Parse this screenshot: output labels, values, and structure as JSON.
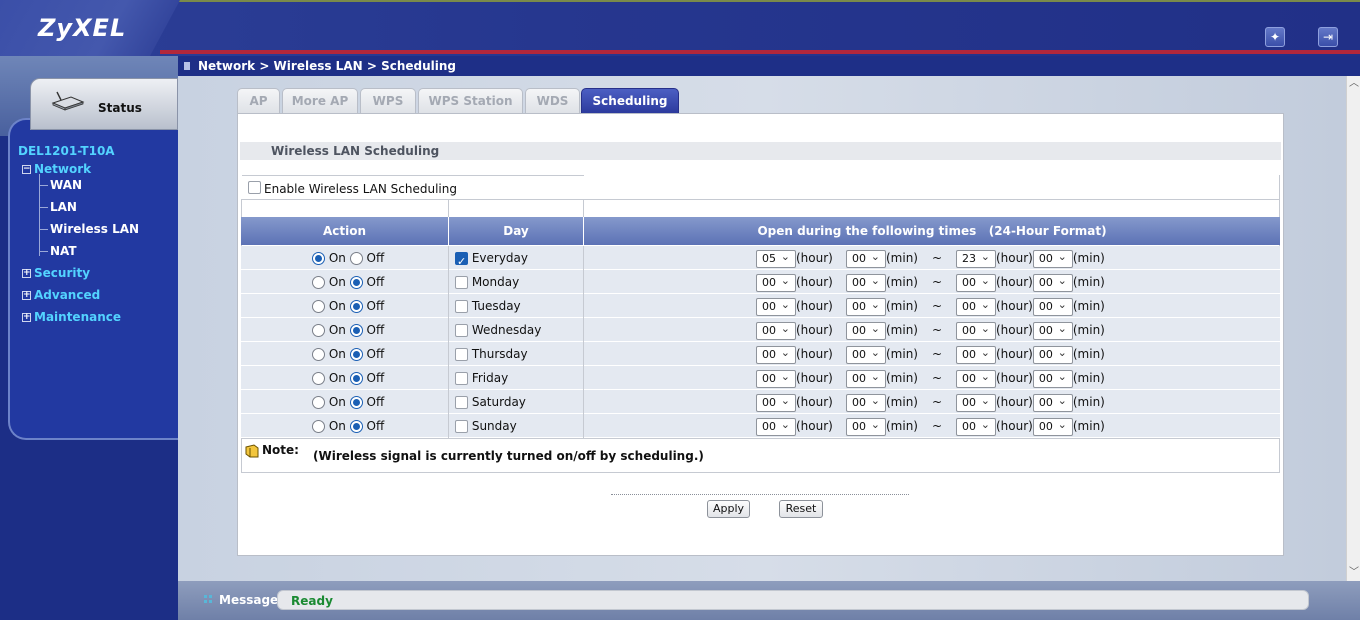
{
  "brand": {
    "logo": "ZyXEL"
  },
  "header": {
    "icons": [
      "wizard-icon",
      "logout-icon"
    ]
  },
  "sidebar": {
    "status_label": "Status",
    "device": "DEL1201-T10A",
    "network": "Network",
    "network_items": [
      "WAN",
      "LAN",
      "Wireless LAN",
      "NAT"
    ],
    "security": "Security",
    "advanced": "Advanced",
    "maintenance": "Maintenance"
  },
  "breadcrumb": "Network > Wireless LAN > Scheduling",
  "tabs": [
    "AP",
    "More AP",
    "WPS",
    "WPS Station",
    "WDS",
    "Scheduling"
  ],
  "active_tab": "Scheduling",
  "section": {
    "title": "Wireless LAN Scheduling",
    "enable_label": "Enable Wireless LAN Scheduling",
    "enable_checked": false
  },
  "table": {
    "headers": {
      "action": "Action",
      "day": "Day",
      "times": "Open during the following times   (24-Hour Format)"
    },
    "labels": {
      "on": "On",
      "off": "Off",
      "hour": "(hour)",
      "min": "(min)",
      "tilde": "~"
    },
    "rows": [
      {
        "day": "Everyday",
        "checked": true,
        "action": "On",
        "start_h": "05",
        "start_m": "00",
        "end_h": "23",
        "end_m": "00"
      },
      {
        "day": "Monday",
        "checked": false,
        "action": "Off",
        "start_h": "00",
        "start_m": "00",
        "end_h": "00",
        "end_m": "00"
      },
      {
        "day": "Tuesday",
        "checked": false,
        "action": "Off",
        "start_h": "00",
        "start_m": "00",
        "end_h": "00",
        "end_m": "00"
      },
      {
        "day": "Wednesday",
        "checked": false,
        "action": "Off",
        "start_h": "00",
        "start_m": "00",
        "end_h": "00",
        "end_m": "00"
      },
      {
        "day": "Thursday",
        "checked": false,
        "action": "Off",
        "start_h": "00",
        "start_m": "00",
        "end_h": "00",
        "end_m": "00"
      },
      {
        "day": "Friday",
        "checked": false,
        "action": "Off",
        "start_h": "00",
        "start_m": "00",
        "end_h": "00",
        "end_m": "00"
      },
      {
        "day": "Saturday",
        "checked": false,
        "action": "Off",
        "start_h": "00",
        "start_m": "00",
        "end_h": "00",
        "end_m": "00"
      },
      {
        "day": "Sunday",
        "checked": false,
        "action": "Off",
        "start_h": "00",
        "start_m": "00",
        "end_h": "00",
        "end_m": "00"
      }
    ]
  },
  "note": {
    "label": "Note:",
    "text": "(Wireless signal is currently turned on/off by scheduling.)"
  },
  "buttons": {
    "apply": "Apply",
    "reset": "Reset"
  },
  "statusbar": {
    "label": "Message",
    "value": "Ready"
  },
  "colors": {
    "header": "#26378f",
    "accent_red": "#b2273b",
    "tab_active": "#2c3a9d",
    "tree_link": "#53d3ff",
    "ready": "#1a8a32"
  }
}
